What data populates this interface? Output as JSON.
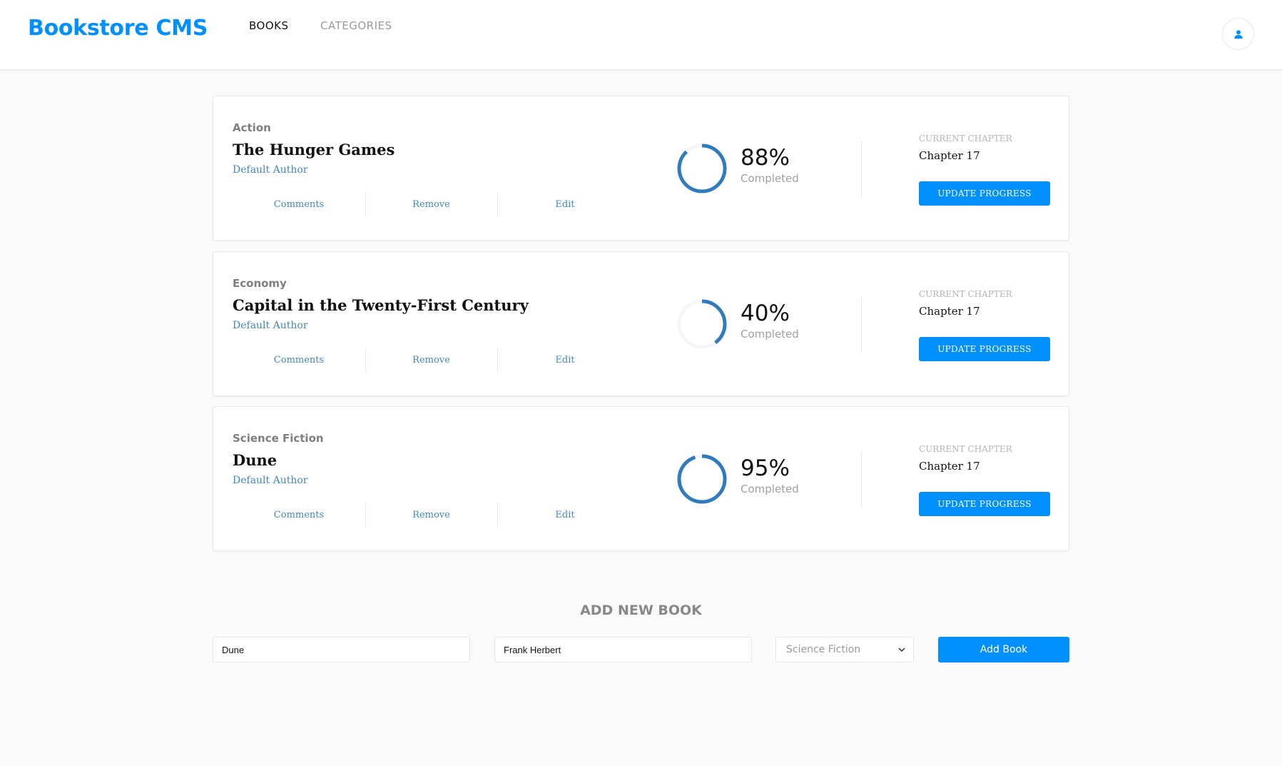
{
  "header": {
    "logo": "Bookstore CMS",
    "nav": [
      {
        "label": "BOOKS",
        "active": true
      },
      {
        "label": "CATEGORIES",
        "active": false
      }
    ],
    "user_icon": "user-icon"
  },
  "books": [
    {
      "genre": "Action",
      "title": "The Hunger Games",
      "author": "Default Author",
      "actions": [
        "Comments",
        "Remove",
        "Edit"
      ],
      "progress": 88,
      "progress_label": "88%",
      "completed_label": "Completed",
      "chapter_label": "CURRENT CHAPTER",
      "chapter": "Chapter 17",
      "update_label": "UPDATE PROGRESS"
    },
    {
      "genre": "Economy",
      "title": "Capital in the Twenty-First Century",
      "author": "Default Author",
      "actions": [
        "Comments",
        "Remove",
        "Edit"
      ],
      "progress": 40,
      "progress_label": "40%",
      "completed_label": "Completed",
      "chapter_label": "CURRENT CHAPTER",
      "chapter": "Chapter 17",
      "update_label": "UPDATE PROGRESS"
    },
    {
      "genre": "Science Fiction",
      "title": "Dune",
      "author": "Default Author",
      "actions": [
        "Comments",
        "Remove",
        "Edit"
      ],
      "progress": 95,
      "progress_label": "95%",
      "completed_label": "Completed",
      "chapter_label": "CURRENT CHAPTER",
      "chapter": "Chapter 17",
      "update_label": "UPDATE PROGRESS"
    }
  ],
  "form": {
    "title": "ADD NEW BOOK",
    "title_value": "Dune",
    "author_value": "Frank Herbert",
    "category_selected": "Science Fiction",
    "submit_label": "Add Book"
  },
  "colors": {
    "accent": "#0290ff",
    "ring": "#307bbe",
    "ring_track": "#f5f6fa"
  }
}
